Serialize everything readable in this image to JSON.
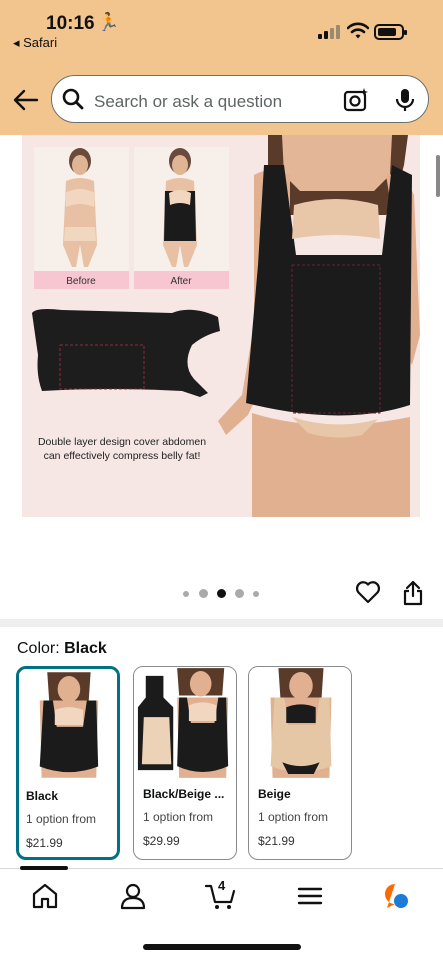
{
  "status_bar": {
    "time": "10:16",
    "back_app": "◂ Safari"
  },
  "search": {
    "placeholder": "Search or ask a question"
  },
  "product_image": {
    "before_label": "Before",
    "after_label": "After",
    "caption_line1": "Double layer design cover abdomen",
    "caption_line2": "can effectively compress belly fat!"
  },
  "carousel": {
    "total": 5,
    "active": 2
  },
  "color_selector": {
    "label": "Color: ",
    "selected_value": "Black",
    "options": [
      {
        "name": "Black",
        "option_text": "1 option from",
        "price": "$21.99",
        "selected": true
      },
      {
        "name": "Black/Beige ...",
        "option_text": "1 option from",
        "price": "$29.99",
        "selected": false
      },
      {
        "name": "Beige",
        "option_text": "1 option from",
        "price": "$21.99",
        "selected": false
      }
    ]
  },
  "tabbar": {
    "cart_count": "4"
  },
  "colors": {
    "header": "#f2c58f",
    "selected_border": "#007185",
    "image_bg": "#f6e7e5"
  }
}
